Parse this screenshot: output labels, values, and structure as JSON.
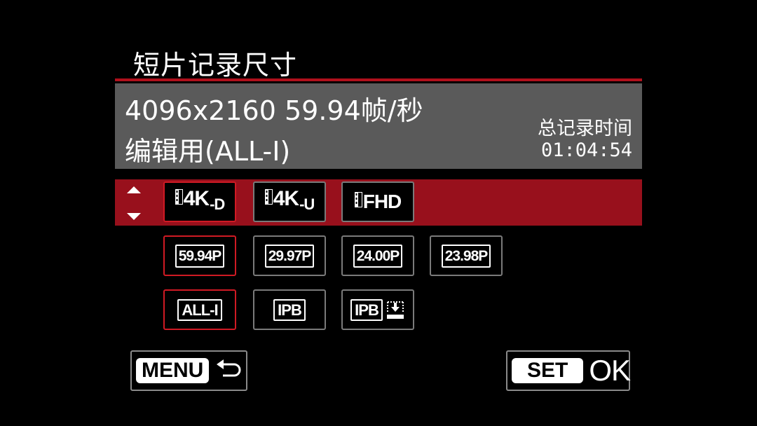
{
  "screen": {
    "title": "短片记录尺寸"
  },
  "info": {
    "line1": "4096x2160 59.94帧/秒",
    "line2": "编辑用(ALL-I)",
    "time_label": "总记录时间",
    "time_value": "01:04:54"
  },
  "resolution_row": {
    "options": [
      {
        "main": "4K",
        "sub": "-D",
        "icon": "film-strip-icon",
        "selected": true
      },
      {
        "main": "4K",
        "sub": "-U",
        "icon": "film-strip-icon",
        "selected": false
      },
      {
        "main": "FHD",
        "sub": "",
        "icon": "film-strip-icon",
        "selected": false
      }
    ]
  },
  "frame_rate_row": {
    "options": [
      {
        "label": "59.94P",
        "selected": true
      },
      {
        "label": "29.97P",
        "selected": false
      },
      {
        "label": "24.00P",
        "selected": false
      },
      {
        "label": "23.98P",
        "selected": false
      }
    ]
  },
  "compression_row": {
    "options": [
      {
        "label": "ALL-I",
        "selected": true
      },
      {
        "label": "IPB",
        "selected": false
      },
      {
        "label": "IPB",
        "icon": "download-icon",
        "selected": false
      }
    ]
  },
  "footer": {
    "menu_label": "MENU",
    "menu_icon": "return-arrow-icon",
    "set_label": "SET",
    "ok_label": "OK"
  },
  "colors": {
    "accent": "#98101c",
    "selected_border": "#d01a24",
    "info_bg": "#5a5a5a"
  }
}
